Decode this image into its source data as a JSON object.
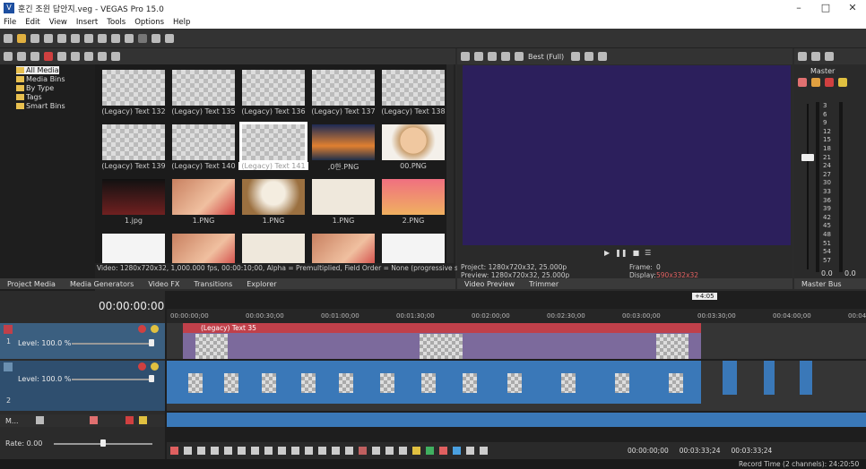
{
  "window": {
    "title": "훈긴 조윈 답안지.veg - VEGAS Pro 15.0",
    "icon": "V"
  },
  "menu": [
    "File",
    "Edit",
    "View",
    "Insert",
    "Tools",
    "Options",
    "Help"
  ],
  "media_tree": [
    "All Media",
    "Media Bins",
    "By Type",
    "Tags",
    "Smart Bins"
  ],
  "media_grid": [
    {
      "label": "(Legacy) Text 132",
      "kind": "checker"
    },
    {
      "label": "(Legacy) Text 135",
      "kind": "checker"
    },
    {
      "label": "(Legacy) Text 136",
      "kind": "checker"
    },
    {
      "label": "(Legacy) Text 137",
      "kind": "checker"
    },
    {
      "label": "(Legacy) Text 138",
      "kind": "checker"
    },
    {
      "label": "(Legacy) Text 139",
      "kind": "checker"
    },
    {
      "label": "(Legacy) Text 140",
      "kind": "checker"
    },
    {
      "label": "(Legacy) Text 141",
      "kind": "checker-selected"
    },
    {
      "label": ",0한.PNG",
      "kind": "city"
    },
    {
      "label": "00.PNG",
      "kind": "face"
    },
    {
      "label": "1.jpg",
      "kind": "poster"
    },
    {
      "label": "1.PNG",
      "kind": "hands"
    },
    {
      "label": "1.PNG",
      "kind": "model"
    },
    {
      "label": "1.PNG",
      "kind": "paper"
    },
    {
      "label": "2.PNG",
      "kind": "pink"
    },
    {
      "label": "",
      "kind": "doc"
    },
    {
      "label": "",
      "kind": "hands"
    },
    {
      "label": "",
      "kind": "paper"
    },
    {
      "label": "",
      "kind": "hands"
    },
    {
      "label": "",
      "kind": "doc"
    }
  ],
  "media_status": "Video: 1280x720x32, 1,000.000 fps, 00:00:10;00, Alpha = Premultiplied, Field Order = None (progressive scan)",
  "tabs_left": [
    "Project Media",
    "Media Generators",
    "Video FX",
    "Transitions",
    "Explorer"
  ],
  "preview": {
    "quality": "Best (Full)",
    "project": "Project: 1280x720x32, 25.000p",
    "preview_line": "Preview: 1280x720x32, 25.000p",
    "frame_label": "Frame:",
    "frame_value": "0",
    "display_label": "Display:",
    "display_value": "590x332x32"
  },
  "tabs_right": [
    "Video Preview",
    "Trimmer"
  ],
  "master": {
    "title": "Master",
    "tab": "Master Bus",
    "scale": [
      "3",
      "6",
      "9",
      "12",
      "15",
      "18",
      "21",
      "24",
      "27",
      "30",
      "33",
      "36",
      "39",
      "42",
      "45",
      "48",
      "51",
      "54",
      "57"
    ],
    "readout_left": "0.0",
    "readout_right": "0.0"
  },
  "timeline": {
    "timecode": "00:00:00:00",
    "cursor_label": "+4:05",
    "ruler": [
      "00:00:00;00",
      "00:00:30;00",
      "00:01:00;00",
      "00:01:30;00",
      "00:02:00;00",
      "00:02:30;00",
      "00:03:00;00",
      "00:03:30;00",
      "00:04:00;00",
      "00:04:30;00"
    ],
    "track1_number": "1",
    "track1_level": "Level: 100.0 %",
    "track2_number": "2",
    "track2_level": "Level: 100.0 %",
    "video_clip_title": "(Legacy) Text 35",
    "master_label": "M...",
    "rate": "Rate: 0.00"
  },
  "transport": {
    "time_start": "00:00:00;00",
    "time_end": "00:03:33;24",
    "time_length": "00:03:33;24"
  },
  "status": {
    "record_time": "Record Time (2 channels): 24:20:50"
  }
}
